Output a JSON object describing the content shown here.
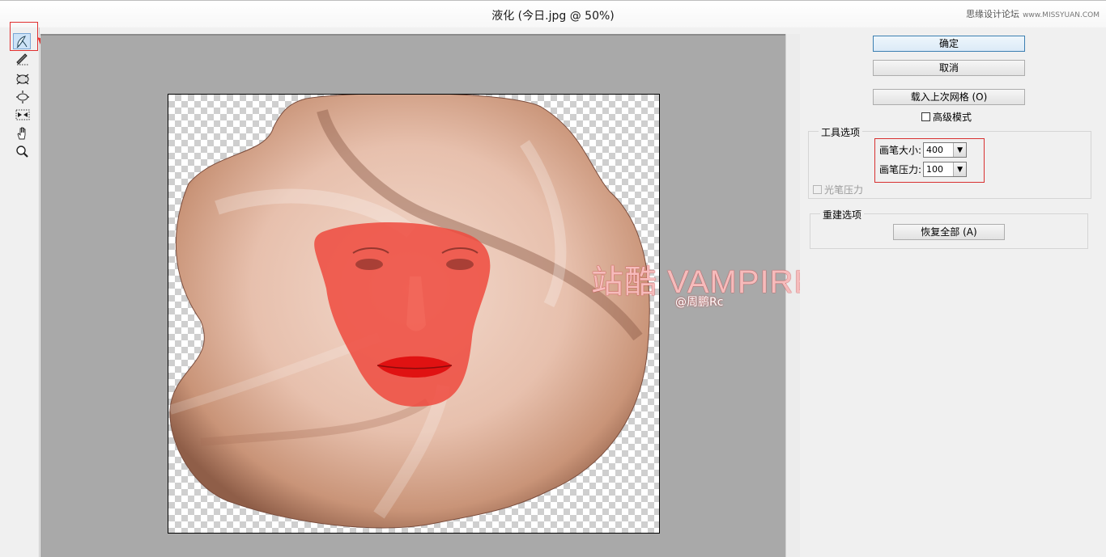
{
  "window": {
    "title": "液化 (今日.jpg @ 50%)",
    "site_watermark": "思缘设计论坛",
    "site_watermark_url": "www.MISSYUAN.COM"
  },
  "tools": [
    {
      "name": "forward-warp-tool",
      "icon": "warp-brush-icon",
      "active": true
    },
    {
      "name": "reconstruct-tool",
      "icon": "reconstruct-brush-icon"
    },
    {
      "name": "pucker-tool",
      "icon": "pucker-icon"
    },
    {
      "name": "bloat-tool",
      "icon": "bloat-icon"
    },
    {
      "name": "push-left-tool",
      "icon": "push-left-icon"
    },
    {
      "name": "hand-tool",
      "icon": "hand-icon"
    },
    {
      "name": "zoom-tool",
      "icon": "zoom-icon"
    }
  ],
  "canvas": {
    "watermark_brand": "站酷 VAMPIREE",
    "watermark_author": "@周鹏Rc"
  },
  "panel": {
    "ok_label": "确定",
    "cancel_label": "取消",
    "load_mesh_label": "载入上次网格 (O)",
    "advanced_mode_label": "高级模式",
    "advanced_mode_checked": false,
    "tool_options_title": "工具选项",
    "brush_size_label": "画笔大小:",
    "brush_size_value": "400",
    "brush_pressure_label": "画笔压力:",
    "brush_pressure_value": "100",
    "stylus_pressure_label": "光笔压力",
    "stylus_pressure_checked": false,
    "reconstruct_title": "重建选项",
    "restore_all_label": "恢复全部 (A)"
  },
  "colors": {
    "highlight_red": "#e03030",
    "canvas_bg": "#a9a9a9",
    "default_button_border": "#3c7fb1"
  }
}
